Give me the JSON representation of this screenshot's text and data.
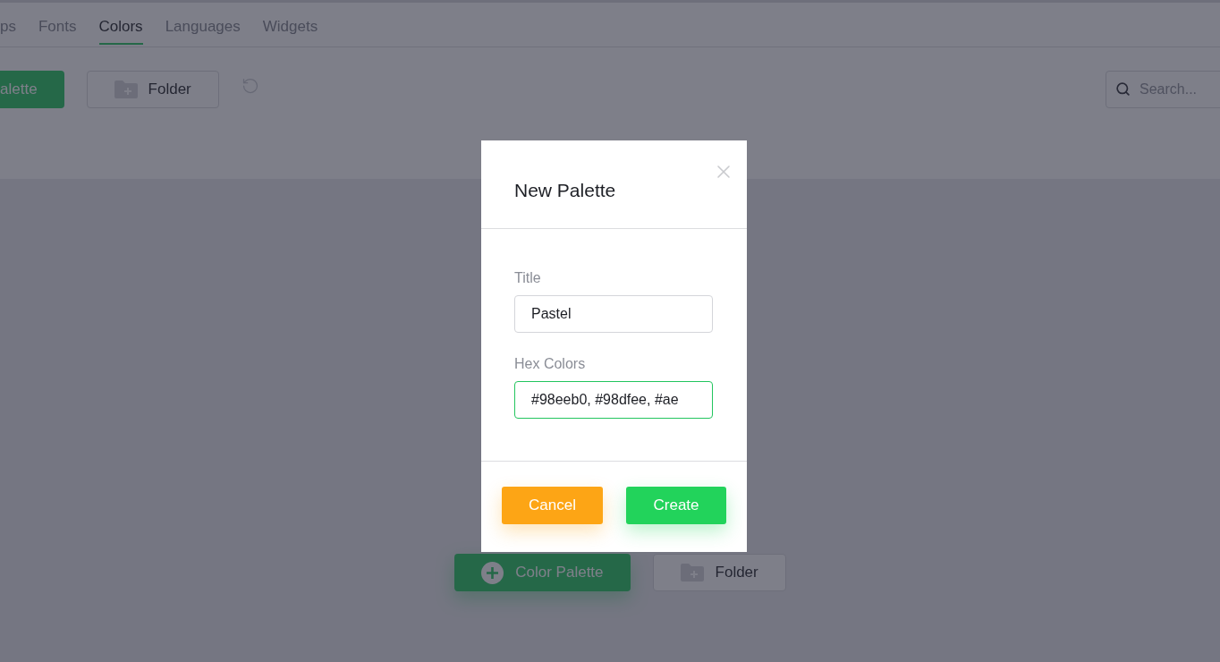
{
  "tabs": [
    {
      "label": "ps",
      "selected": false
    },
    {
      "label": "Fonts",
      "selected": false
    },
    {
      "label": "Colors",
      "selected": true
    },
    {
      "label": "Languages",
      "selected": false
    },
    {
      "label": "Widgets",
      "selected": false
    }
  ],
  "toolbar": {
    "primary_button": "alette",
    "folder_button": "Folder",
    "search": {
      "placeholder": "Search..."
    }
  },
  "empty_state": {
    "buttons": [
      {
        "label": "Color Palette",
        "kind": "primary"
      },
      {
        "label": "Folder",
        "kind": "folder"
      }
    ]
  },
  "dialog": {
    "title": "New Palette",
    "fields": [
      {
        "label": "Title",
        "value": "Pastel",
        "focused": false
      },
      {
        "label": "Hex Colors",
        "value": "#98eeb0, #98dfee, #ae",
        "focused": true
      }
    ],
    "buttons": [
      {
        "label": "Cancel",
        "kind": "cancel"
      },
      {
        "label": "Create",
        "kind": "confirm"
      }
    ]
  }
}
